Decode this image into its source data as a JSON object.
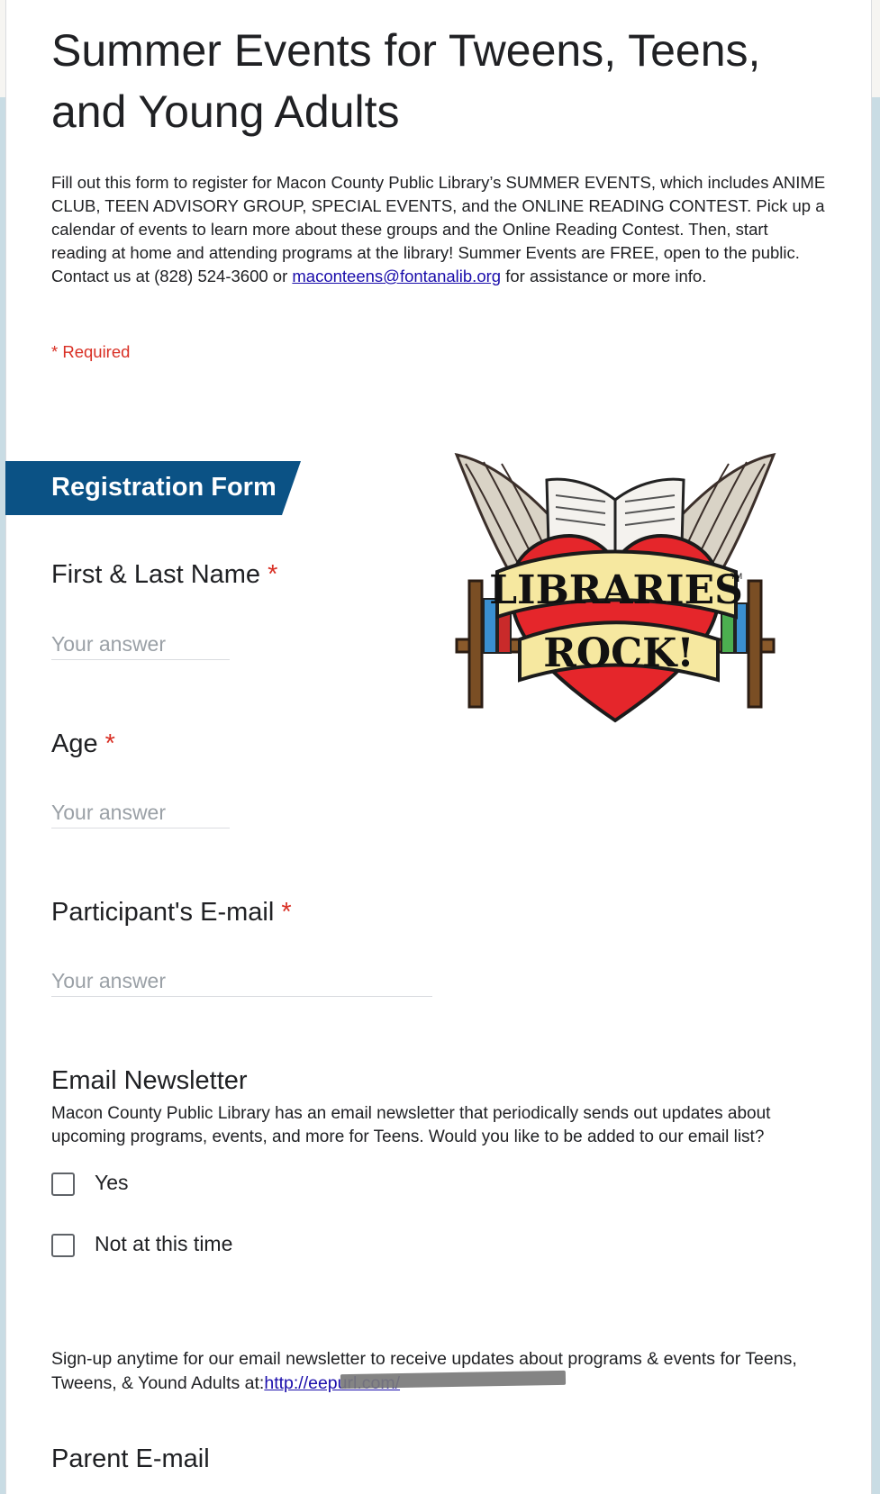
{
  "form": {
    "title": "Summer Events for Tweens, Teens, and Young Adults",
    "description_before_link": "Fill out this form to register for Macon County Public Library’s SUMMER EVENTS, which includes ANIME CLUB, TEEN ADVISORY GROUP, SPECIAL EVENTS, and the ONLINE READING CONTEST. Pick up a calendar of events to learn more about these groups and the Online Reading Contest. Then, start reading at home and attending programs at the library! Summer Events are FREE, open to the public. Contact us at (828) 524-3600 or ",
    "contact_email": "maconteens@fontanalib.org",
    "description_after_link": " for assistance or more info.",
    "required_note": "* Required"
  },
  "section": {
    "title": "Registration Form",
    "banner_color": "#0b5285"
  },
  "logo": {
    "line1": "LIBRARIES",
    "line2": "ROCK!",
    "tm": "TM"
  },
  "questions": {
    "name": {
      "label": "First & Last Name",
      "required_mark": "*",
      "placeholder": "Your answer"
    },
    "age": {
      "label": "Age",
      "required_mark": "*",
      "placeholder": "Your answer"
    },
    "email": {
      "label": "Participant's E-mail",
      "required_mark": "*",
      "placeholder": "Your answer"
    },
    "newsletter": {
      "label": "Email Newsletter",
      "help": "Macon County Public Library has an email newsletter that periodically sends out updates about upcoming programs, events, and more for Teens. Would you like to be added to our email list?",
      "options": [
        "Yes",
        "Not at this time"
      ]
    },
    "parent_email": {
      "label": "Parent E-mail"
    }
  },
  "signup": {
    "text": "Sign-up anytime for our email newsletter to receive updates about programs & events for Teens, Tweens, & Yound Adults at:",
    "link_text": "http://eepurl.com/"
  },
  "colors": {
    "required_red": "#d93025",
    "link_blue": "#1a0dab"
  }
}
